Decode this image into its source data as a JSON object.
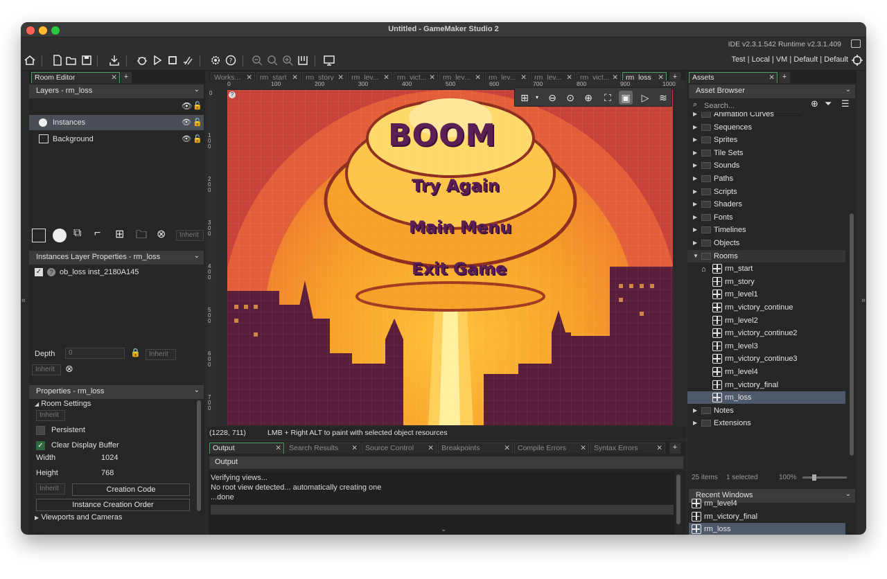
{
  "window": {
    "title": "Untitled - GameMaker Studio 2",
    "version": "IDE v2.3.1.542  Runtime v2.3.1.409"
  },
  "toolbar": {
    "targets": "Test | Local | VM | Default | Default"
  },
  "left": {
    "tab_label": "Room Editor",
    "layers_header": "Layers - rm_loss",
    "layers": [
      "Instances",
      "Background"
    ],
    "inherit_label": "Inherit",
    "instances_header": "Instances Layer Properties - rm_loss",
    "instance_item": "ob_loss  inst_2180A145",
    "depth_label": "Depth",
    "depth_value": "0",
    "properties_header": "Properties - rm_loss",
    "room_settings": "Room Settings",
    "persistent": "Persistent",
    "clear_buffer": "Clear Display Buffer",
    "width_label": "Width",
    "width_value": "1024",
    "height_label": "Height",
    "height_value": "768",
    "creation_code": "Creation Code",
    "instance_order": "Instance Creation Order",
    "viewports": "Viewports and Cameras"
  },
  "center": {
    "tabs": [
      "Works...",
      "rm_start",
      "rm_story",
      "rm_lev...",
      "rm_vict...",
      "rm_lev...",
      "rm_lev...",
      "rm_lev...",
      "rm_vict...",
      "rm_loss"
    ],
    "ruler_x": [
      "0",
      "100",
      "200",
      "300",
      "400",
      "500",
      "600",
      "700",
      "800",
      "900",
      "1000"
    ],
    "ruler_y": [
      "0",
      "100",
      "200",
      "300",
      "400",
      "500",
      "600",
      "700"
    ],
    "room_texts": {
      "title": "BOOM",
      "try_again": "Try Again",
      "main_menu": "Main Menu",
      "exit_game": "Exit Game"
    },
    "status_coords": "(1228, 711)",
    "status_hint": "LMB + Right ALT to paint with selected object resources"
  },
  "output": {
    "tabs": [
      "Output",
      "Search Results",
      "Source Control",
      "Breakpoints",
      "Compile Errors",
      "Syntax Errors"
    ],
    "header": "Output",
    "lines": [
      "Verifying views...",
      "No root view detected... automatically creating one",
      "...done"
    ]
  },
  "assets": {
    "tab_label": "Assets",
    "browser_header": "Asset Browser",
    "search_placeholder": "Search...",
    "folders_top": [
      "Animation Curves",
      "Sequences",
      "Sprites",
      "Tile Sets",
      "Sounds",
      "Paths",
      "Scripts",
      "Shaders",
      "Fonts",
      "Timelines",
      "Objects",
      "Rooms"
    ],
    "rooms": [
      "rm_start",
      "rm_story",
      "rm_level1",
      "rm_victory_continue",
      "rm_level2",
      "rm_victory_continue2",
      "rm_level3",
      "rm_victory_continue3",
      "rm_level4",
      "rm_victory_final",
      "rm_loss"
    ],
    "folders_bottom": [
      "Notes",
      "Extensions"
    ],
    "count": "25 items",
    "selected": "1 selected",
    "zoom": "100%",
    "recent_header": "Recent Windows",
    "recent": [
      "rm_level4",
      "rm_victory_final",
      "rm_loss"
    ]
  },
  "colors": {
    "accent": "#4aa36b",
    "selected_row": "#4e5a6a",
    "room_bg": "#e8713a"
  }
}
